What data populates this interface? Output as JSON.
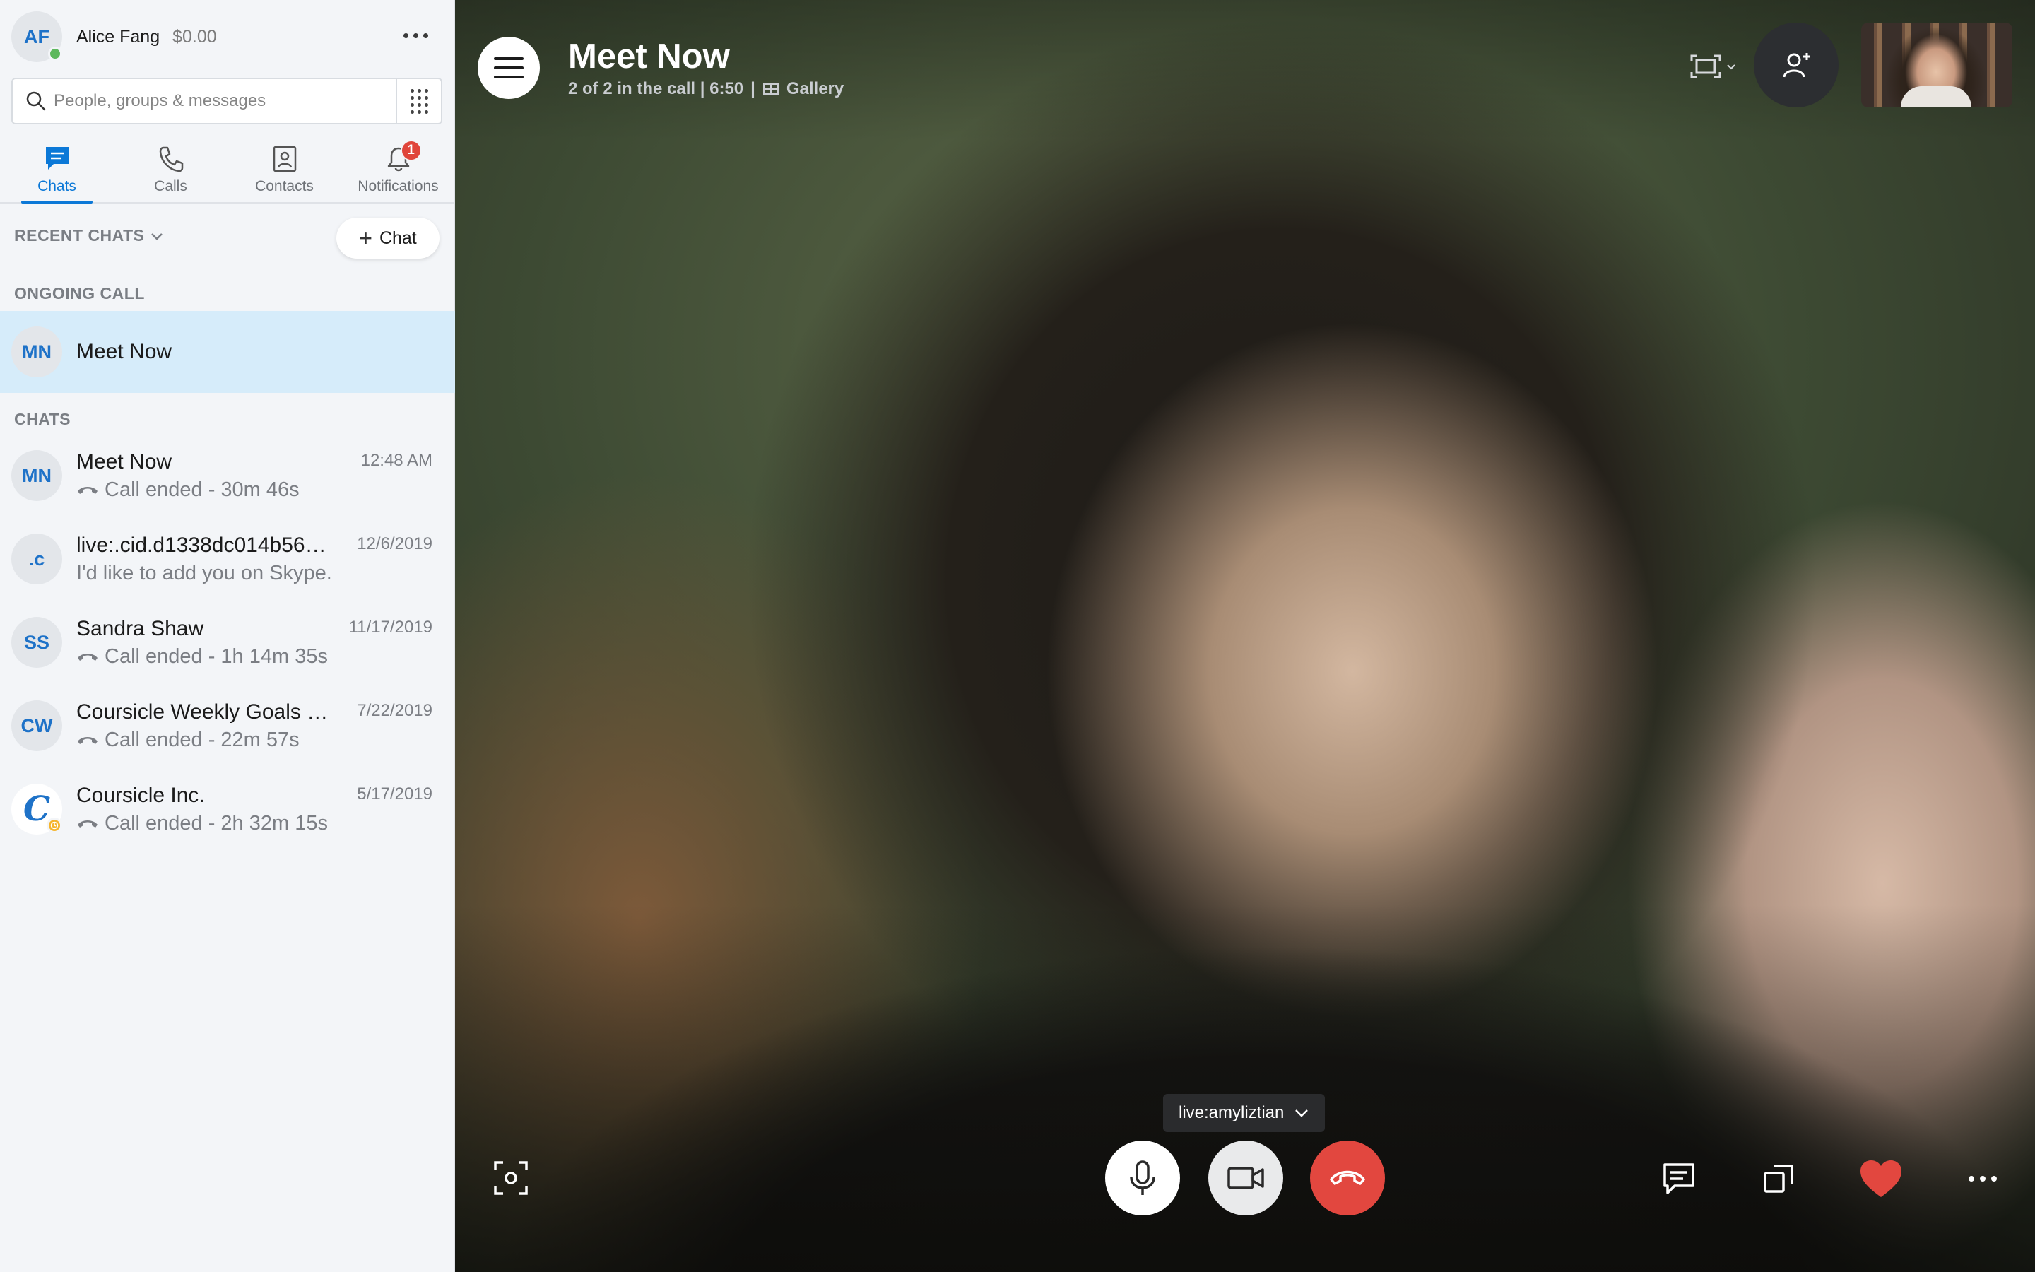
{
  "profile": {
    "initials": "AF",
    "name": "Alice Fang",
    "credit": "$0.00"
  },
  "search": {
    "placeholder": "People, groups & messages"
  },
  "tabs": [
    {
      "label": "Chats",
      "icon": "chat-icon",
      "active": true
    },
    {
      "label": "Calls",
      "icon": "phone-icon"
    },
    {
      "label": "Contacts",
      "icon": "contacts-icon"
    },
    {
      "label": "Notifications",
      "icon": "bell-icon",
      "badge": "1"
    }
  ],
  "recent_header": "RECENT CHATS",
  "new_chat_label": "Chat",
  "ongoing": {
    "section": "ONGOING CALL",
    "initials": "MN",
    "name": "Meet Now"
  },
  "chats_section": "CHATS",
  "chats": [
    {
      "initials": "MN",
      "name": "Meet Now",
      "sub": "Call ended - 30m 46s",
      "date": "12:48 AM",
      "call": true
    },
    {
      "initials": ".c",
      "name": "live:.cid.d1338dc014b56…",
      "sub": "I'd like to add you on Skype.",
      "date": "12/6/2019",
      "call": false
    },
    {
      "initials": "SS",
      "name": "Sandra Shaw",
      "sub": "Call ended - 1h 14m 35s",
      "date": "11/17/2019",
      "call": true
    },
    {
      "initials": "CW",
      "name": "Coursicle Weekly Goals …",
      "sub": "Call ended - 22m 57s",
      "date": "7/22/2019",
      "call": true
    },
    {
      "initials": "C",
      "name": "Coursicle Inc.",
      "sub": "Call ended - 2h 32m 15s",
      "date": "5/17/2019",
      "call": true
    }
  ],
  "call": {
    "title": "Meet Now",
    "status": "2 of 2 in the call | 6:50",
    "separator": "|",
    "gallery_label": "Gallery",
    "participant": "live:amyliztian"
  },
  "colors": {
    "accent": "#0b78d7",
    "end_call": "#e2473f",
    "badge": "#e0453b",
    "online": "#5cb85c",
    "away": "#f5b52e"
  }
}
